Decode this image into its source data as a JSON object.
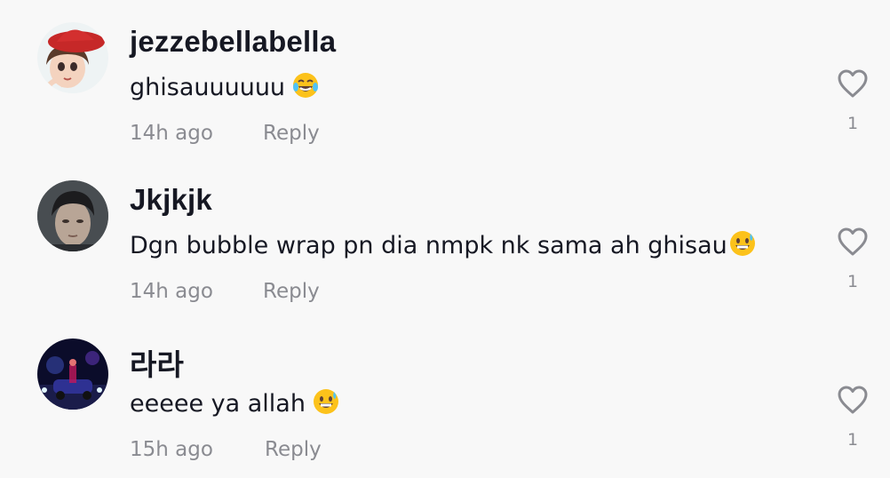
{
  "comments": [
    {
      "username": "jezzebellabella",
      "text": "ghisauuuuuu",
      "emoji": "laughing-tears-emoji",
      "time": "14h ago",
      "reply_label": "Reply",
      "likes": "1",
      "avatar": "cartoon-girl-red-hat"
    },
    {
      "username": "Jkjkjk",
      "text": "Dgn bubble wrap pn dia nmpk nk sama ah ghisau",
      "emoji": "grinning-sweat-emoji",
      "time": "14h ago",
      "reply_label": "Reply",
      "likes": "1",
      "avatar": "young-man-photo"
    },
    {
      "username": "라라",
      "text": "eeeee ya allah",
      "emoji": "grinning-sweat-emoji",
      "time": "15h ago",
      "reply_label": "Reply",
      "likes": "1",
      "avatar": "night-street-photo"
    }
  ],
  "colors": {
    "background": "#f8f8f8",
    "primary_text": "#161823",
    "secondary_text": "#8a8b91",
    "heart_outline": "#8a8b91"
  }
}
